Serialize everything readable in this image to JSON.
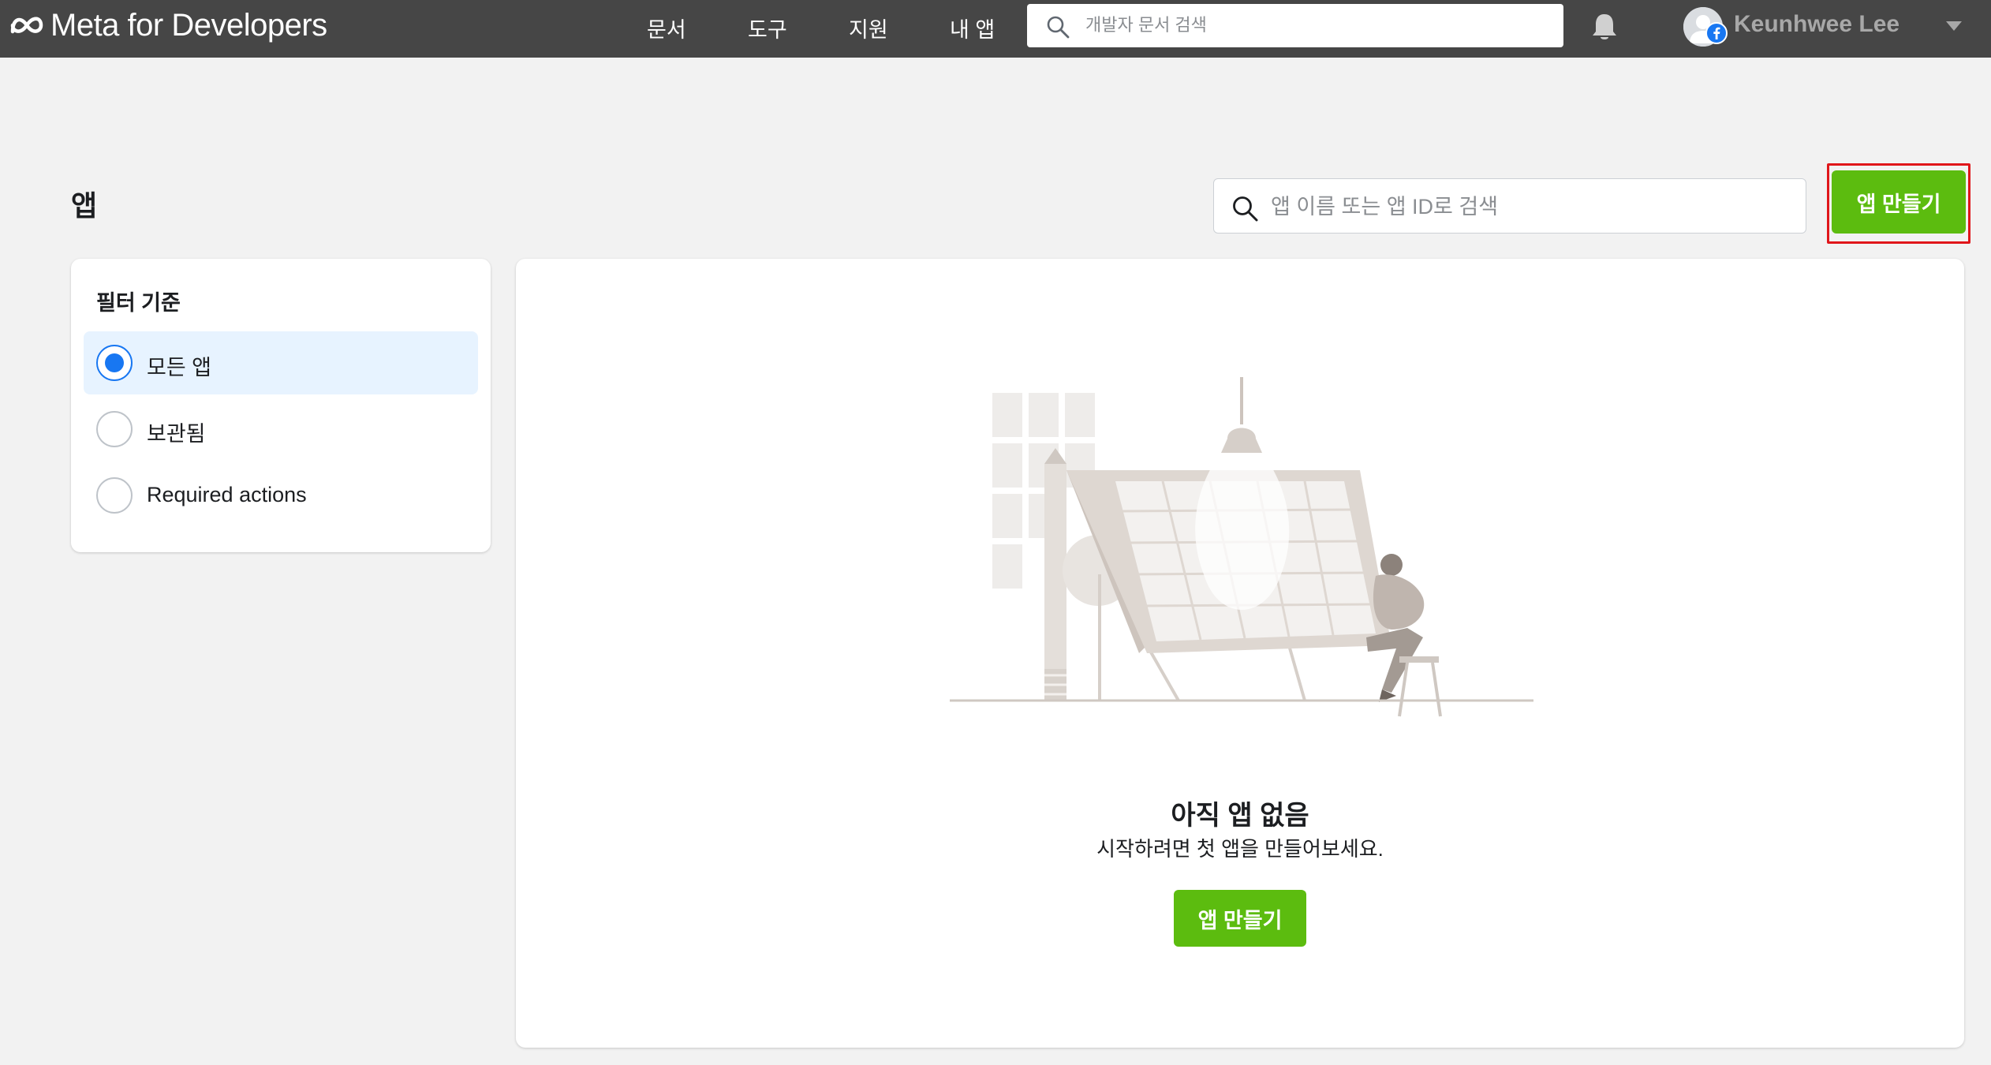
{
  "header": {
    "brand": "Meta for Developers",
    "nav": [
      {
        "label": "문서"
      },
      {
        "label": "도구"
      },
      {
        "label": "지원"
      },
      {
        "label": "내 앱"
      }
    ],
    "search_placeholder": "개발자 문서 검색",
    "user_name": "Keunhwee Lee"
  },
  "page": {
    "title": "앱",
    "search_placeholder": "앱 이름 또는 앱 ID로 검색",
    "create_button": "앱 만들기"
  },
  "filter": {
    "title": "필터 기준",
    "options": [
      {
        "label": "모든 앱",
        "selected": true
      },
      {
        "label": "보관됨",
        "selected": false
      },
      {
        "label": "Required actions",
        "selected": false
      }
    ]
  },
  "empty_state": {
    "title": "아직 앱 없음",
    "subtitle": "시작하려면 첫 앱을 만들어보세요.",
    "button": "앱 만들기"
  },
  "colors": {
    "topbar": "#464646",
    "accent_green": "#5cbc0f",
    "radio_blue": "#1877f2",
    "highlight_red": "#e0161a"
  },
  "icons": {
    "brand": "meta-infinity-icon",
    "search": "search-icon",
    "bell": "bell-icon",
    "avatar": "user-avatar-icon",
    "badge": "facebook-badge-icon",
    "caret": "caret-down-icon"
  }
}
